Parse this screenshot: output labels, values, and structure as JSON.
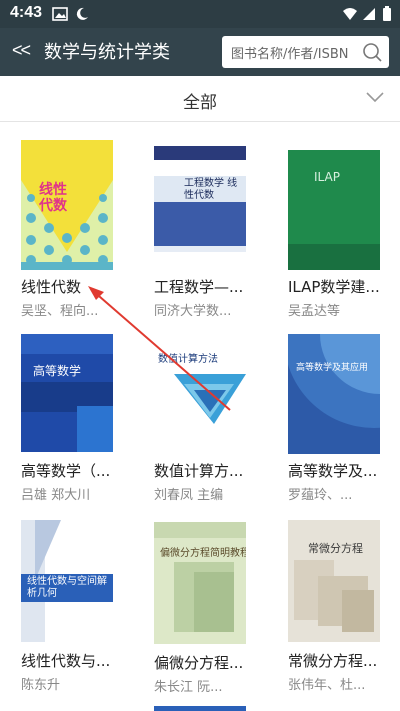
{
  "status_bar": {
    "time": "4:43"
  },
  "header": {
    "back_label": "<<",
    "title": "数学与统计学类",
    "search_placeholder": "图书名称/作者/ISBN"
  },
  "filter": {
    "label": "全部"
  },
  "books": [
    {
      "title": "线性代数",
      "author": "吴坚、程向...",
      "cover_title": "线性代数"
    },
    {
      "title": "工程数学—...",
      "author": "同济大学数...",
      "cover_title": "工程数学 线性代数"
    },
    {
      "title": "ILAP数学建...",
      "author": "吴孟达等",
      "cover_title": "ILAP"
    },
    {
      "title": "高等数学（...",
      "author": "吕雄 郑大川",
      "cover_title": "高等数学"
    },
    {
      "title": "数值计算方...",
      "author": "刘春凤 主编",
      "cover_title": "数值计算方法"
    },
    {
      "title": "高等数学及...",
      "author": "罗蕴玲、...",
      "cover_title": "高等数学及其应用"
    },
    {
      "title": "线性代数与...",
      "author": "陈东升",
      "cover_title": "线性代数与空间解析几何"
    },
    {
      "title": "偏微分方程...",
      "author": "朱长江 阮...",
      "cover_title": "偏微分方程简明教程"
    },
    {
      "title": "常微分方程...",
      "author": "张伟年、杜...",
      "cover_title": "常微分方程"
    }
  ]
}
